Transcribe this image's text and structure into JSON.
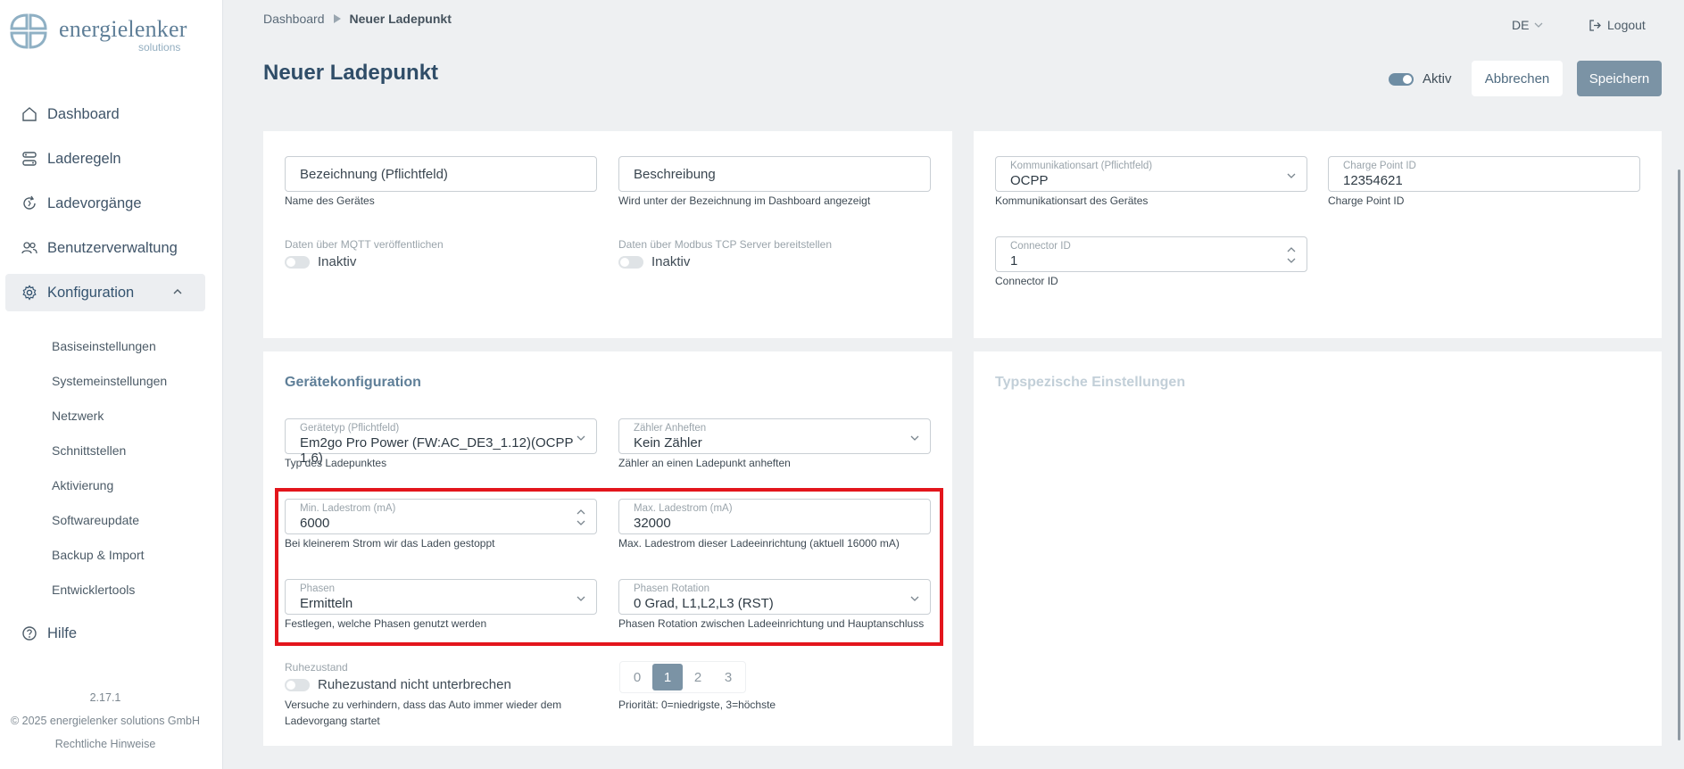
{
  "brand": {
    "name": "energielenker",
    "sub": "solutions"
  },
  "nav": {
    "dashboard": "Dashboard",
    "laderegeln": "Laderegeln",
    "ladevorgaenge": "Ladevorgänge",
    "benutzerverwaltung": "Benutzerverwaltung",
    "konfiguration": "Konfiguration",
    "hilfe": "Hilfe",
    "sub": [
      "Basiseinstellungen",
      "Systemeinstellungen",
      "Netzwerk",
      "Schnittstellen",
      "Aktivierung",
      "Softwareupdate",
      "Backup & Import",
      "Entwicklertools"
    ]
  },
  "footer": {
    "version": "2.17.1",
    "copyright": "© 2025 energielenker solutions GmbH",
    "legal": "Rechtliche Hinweise"
  },
  "breadcrumb": {
    "root": "Dashboard",
    "current": "Neuer Ladepunkt"
  },
  "header": {
    "language": "DE",
    "logout": "Logout"
  },
  "page": {
    "title": "Neuer Ladepunkt",
    "active_label": "Aktiv",
    "cancel": "Abbrechen",
    "save": "Speichern"
  },
  "general": {
    "name_placeholder": "Bezeichnung (Pflichtfeld)",
    "name_hint": "Name des Gerätes",
    "desc_placeholder": "Beschreibung",
    "desc_hint": "Wird unter der Bezeichnung im Dashboard angezeigt",
    "mqtt_label": "Daten über MQTT veröffentlichen",
    "mqtt_state": "Inaktiv",
    "modbus_label": "Daten über Modbus TCP Server bereitstellen",
    "modbus_state": "Inaktiv"
  },
  "comm": {
    "type_label": "Kommunikationsart (Pflichtfeld)",
    "type_value": "OCPP",
    "type_hint": "Kommunikationsart des Gerätes",
    "cpid_label": "Charge Point ID",
    "cpid_value": "12354621",
    "cpid_hint": "Charge Point ID",
    "connector_label": "Connector ID",
    "connector_value": "1",
    "connector_hint": "Connector ID"
  },
  "device": {
    "title": "Gerätekonfiguration",
    "type_label": "Gerätetyp (Pflichtfeld)",
    "type_value": "Em2go Pro Power (FW:AC_DE3_1.12)(OCPP 1.6)",
    "type_hint": "Typ des Ladepunktes",
    "meter_label": "Zähler Anheften",
    "meter_value": "Kein Zähler",
    "meter_hint": "Zähler an einen Ladepunkt anheften",
    "min_label": "Min. Ladestrom (mA)",
    "min_value": "6000",
    "min_hint": "Bei kleinerem Strom wir das Laden gestoppt",
    "max_label": "Max. Ladestrom (mA)",
    "max_value": "32000",
    "max_hint": "Max. Ladestrom dieser Ladeeinrichtung (aktuell 16000 mA)",
    "phases_label": "Phasen",
    "phases_value": "Ermitteln",
    "phases_hint": "Festlegen, welche Phasen genutzt werden",
    "rotation_label": "Phasen Rotation",
    "rotation_value": "0 Grad, L1,L2,L3 (RST)",
    "rotation_hint": "Phasen Rotation zwischen Ladeeinrichtung und Hauptanschluss",
    "idle_label": "Ruhezustand",
    "idle_toggle": "Ruhezustand nicht unterbrechen",
    "idle_hint_1": "Versuche zu verhindern, dass das Auto immer wieder dem",
    "idle_hint_2": "Ladevorgang startet",
    "priority_options": [
      "0",
      "1",
      "2",
      "3"
    ],
    "priority_selected": "1",
    "priority_hint": "Priorität: 0=niedrigste, 3=höchste"
  },
  "type_settings": {
    "title": "Typspezische Einstellungen"
  },
  "colors": {
    "accent": "#7b93a5",
    "title": "#2f4d68",
    "highlight": "#e3151c"
  }
}
